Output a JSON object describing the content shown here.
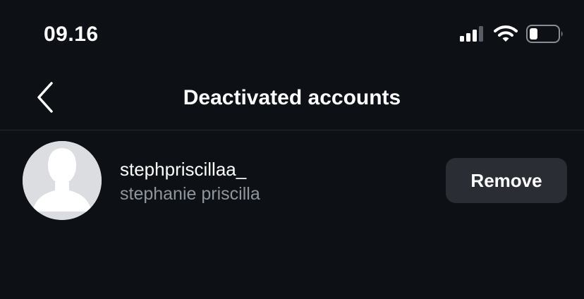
{
  "status_bar": {
    "time": "09.16",
    "icons": [
      "cellular-signal-icon",
      "wifi-icon",
      "battery-icon"
    ]
  },
  "header": {
    "title": "Deactivated accounts",
    "back_icon": "chevron-left-icon"
  },
  "accounts": [
    {
      "username": "stephpriscillaa_",
      "full_name": "stephanie priscilla",
      "avatar": "default-avatar-icon",
      "action_label": "Remove"
    }
  ],
  "colors": {
    "background": "#0d1014",
    "button": "#2a2d33",
    "secondary_text": "#8e959d",
    "divider": "#262a30"
  }
}
